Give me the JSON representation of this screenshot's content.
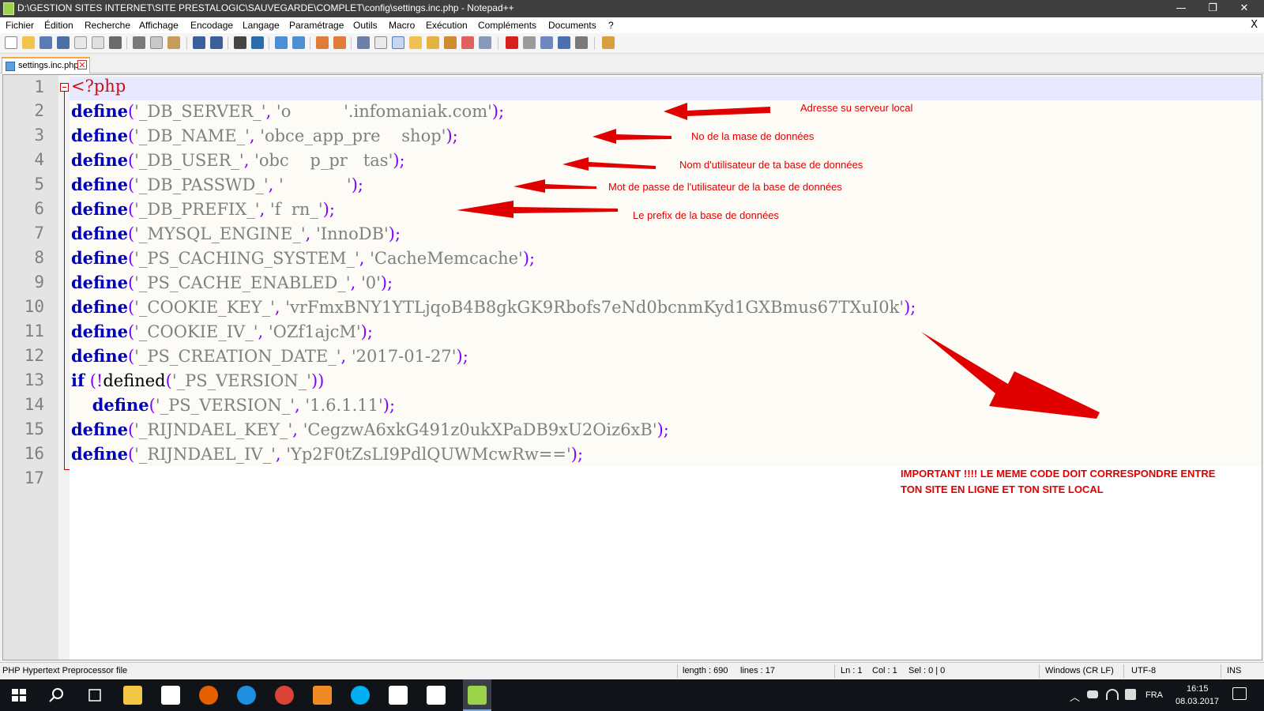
{
  "window": {
    "title": "D:\\GESTION SITES INTERNET\\SITE PRESTALOGIC\\SAUVEGARDE\\COMPLET\\config\\settings.inc.php - Notepad++",
    "minimize": "—",
    "maximize": "❐",
    "close": "✕"
  },
  "menu": [
    "Fichier",
    "Édition",
    "Recherche",
    "Affichage",
    "Encodage",
    "Langage",
    "Paramétrage",
    "Outils",
    "Macro",
    "Exécution",
    "Compléments",
    "Documents",
    "?"
  ],
  "menu_close": "X",
  "tab": {
    "label": "settings.inc.php",
    "close": "✕"
  },
  "editor": {
    "line_numbers": [
      "1",
      "2",
      "3",
      "4",
      "5",
      "6",
      "7",
      "8",
      "9",
      "10",
      "11",
      "12",
      "13",
      "14",
      "15",
      "16",
      "17"
    ],
    "code": {
      "l1": "<?php",
      "l2": {
        "kw": "define",
        "const": "'_DB_SERVER_'",
        "value": "'o          '.infomaniak.com'"
      },
      "l3": {
        "kw": "define",
        "const": "'_DB_NAME_'",
        "value": "'obce_app_pre    shop'"
      },
      "l4": {
        "kw": "define",
        "const": "'_DB_USER_'",
        "value": "'obc    p_pr   tas'"
      },
      "l5": {
        "kw": "define",
        "const": "'_DB_PASSWD_'",
        "value": "'            '"
      },
      "l6": {
        "kw": "define",
        "const": "'_DB_PREFIX_'",
        "value": "'f  rn_'"
      },
      "l7": {
        "kw": "define",
        "const": "'_MYSQL_ENGINE_'",
        "value": "'InnoDB'"
      },
      "l8": {
        "kw": "define",
        "const": "'_PS_CACHING_SYSTEM_'",
        "value": "'CacheMemcache'"
      },
      "l9": {
        "kw": "define",
        "const": "'_PS_CACHE_ENABLED_'",
        "value": "'0'"
      },
      "l10": {
        "kw": "define",
        "const": "'_COOKIE_KEY_'",
        "value": "'vrFmxBNY1YTLjqoB4B8gkGK9Rbofs7eNd0bcnmKyd1GXBmus67TXuI0k'"
      },
      "l11": {
        "kw": "define",
        "const": "'_COOKIE_IV_'",
        "value": "'OZf1ajcM'"
      },
      "l12": {
        "kw": "define",
        "const": "'_PS_CREATION_DATE_'",
        "value": "'2017-01-27'"
      },
      "l13": {
        "kw": "if",
        "fn": "defined",
        "const": "'_PS_VERSION_'"
      },
      "l14": {
        "kw": "define",
        "const": "'_PS_VERSION_'",
        "value": "'1.6.1.11'"
      },
      "l15": {
        "kw": "define",
        "const": "'_RIJNDAEL_KEY_'",
        "value": "'CegzwA6xkG491z0ukXPaDB9xU2Oiz6xB'"
      },
      "l16": {
        "kw": "define",
        "const": "'_RIJNDAEL_IV_'",
        "value": "'Yp2F0tZsLI9PdlQUWMcwRw=='"
      }
    }
  },
  "annotations": {
    "server": "Adresse su serveur local",
    "dbname": "No de la mase de données",
    "dbuser": "Nom d'utilisateur de ta base de données",
    "dbpass": "Mot de passe de l'utilisateur de la base de données",
    "prefix": "Le prefix de la base de données",
    "important_line1": "IMPORTANT !!!!  LE MEME CODE DOIT CORRESPONDRE ENTRE",
    "important_line2": "TON SITE EN LIGNE ET TON SITE LOCAL"
  },
  "status": {
    "filetype": "PHP Hypertext Preprocessor file",
    "length": "length : 690",
    "lines": "lines : 17",
    "ln": "Ln : 1",
    "col": "Col : 1",
    "sel": "Sel : 0 | 0",
    "eol": "Windows (CR LF)",
    "encoding": "UTF-8",
    "mode": "INS"
  },
  "taskbar": {
    "lang": "FRA",
    "time": "16:15",
    "date": "08.03.2017"
  },
  "colors": {
    "keyword": "#0000b8",
    "operator": "#8000ff",
    "string": "#808080",
    "php_tag": "#d01010",
    "annotation": "#e00000"
  }
}
